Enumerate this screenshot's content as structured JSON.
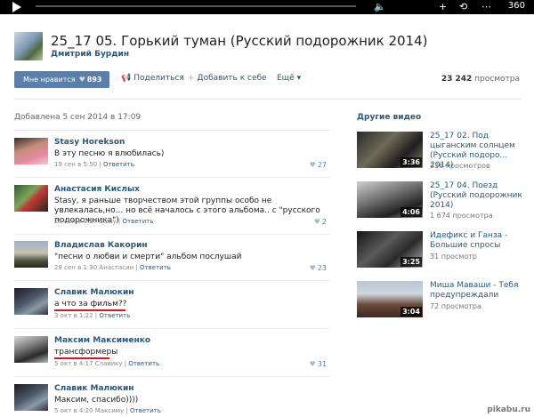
{
  "player": {
    "quality": "360",
    "controls": {
      "plus": "+",
      "repeat": "⟲",
      "more": "⋯"
    }
  },
  "video": {
    "title": "25_17 05. Горький туман (Русский подорожник 2014)",
    "author": "Дмитрий Бурдин"
  },
  "actions": {
    "like_label": "Мне нравится",
    "like_count": "893",
    "share": "Поделиться",
    "add": "Добавить к себе",
    "more": "Ещё",
    "views_count": "23 242",
    "views_word": " просмотра"
  },
  "added_date": "Добавлена 5 сен 2014 в 17:09",
  "comments": [
    {
      "name": "Stasy Horekson",
      "text": "В эту песню я влюбилась)",
      "time": "19 сен в 5:50",
      "reply_to": "",
      "reply": "Ответить",
      "likes": "27"
    },
    {
      "name": "Анастасия Кислых",
      "text": "Stasy, я раньше творчеством этой группы особо не увлекалась,но... но всё началось с этого альбома.. с \"русского подорожника\")",
      "time": "25 сен в 0:27",
      "reply_to": "Stasy",
      "reply": "Ответить",
      "likes": "2"
    },
    {
      "name": "Владислав Какорин",
      "text": "\"песни о любви и смерти\" альбом послушай",
      "time": "28 сен в 1:30",
      "reply_to": "Анастасии",
      "reply": "Ответить",
      "likes": "23"
    },
    {
      "name": "Славик Малюкин",
      "text": "а что за фильм??",
      "time": "3 окт в 1:22",
      "reply_to": "",
      "reply": "Ответить",
      "likes": ""
    },
    {
      "name": "Максим Максименко",
      "text": "трансформеры",
      "time": "5 окт в 4:17",
      "reply_to": "Славику",
      "reply": "Ответить",
      "likes": "31"
    },
    {
      "name": "Славик Малюкин",
      "text": "Максим, спасибо))))",
      "time": "5 окт в 4:20",
      "reply_to": "Максиму",
      "reply": "Ответить",
      "likes": ""
    }
  ],
  "sidebar": {
    "title": "Другие видео",
    "videos": [
      {
        "title": "25_17 02. Под цыганским солнцем (Русский подоро... 2014)",
        "views": "336 просмотров",
        "duration": "3:36"
      },
      {
        "title": "25_17 04. Поезд (Русский подорожник 2014)",
        "views": "1 674 просмотра",
        "duration": "4:06"
      },
      {
        "title": "Идефикс и Ганза - Большие спросы",
        "views": "31 просмотр",
        "duration": "3:25"
      },
      {
        "title": "Миша Маваши - Тебя предупреждали",
        "views": "72 просмотра",
        "duration": "3:04"
      }
    ]
  },
  "watermark": "pikabu.ru",
  "colors": {
    "link": "#2b587a",
    "button": "#5b7fa6",
    "underline": "#d8171e"
  }
}
